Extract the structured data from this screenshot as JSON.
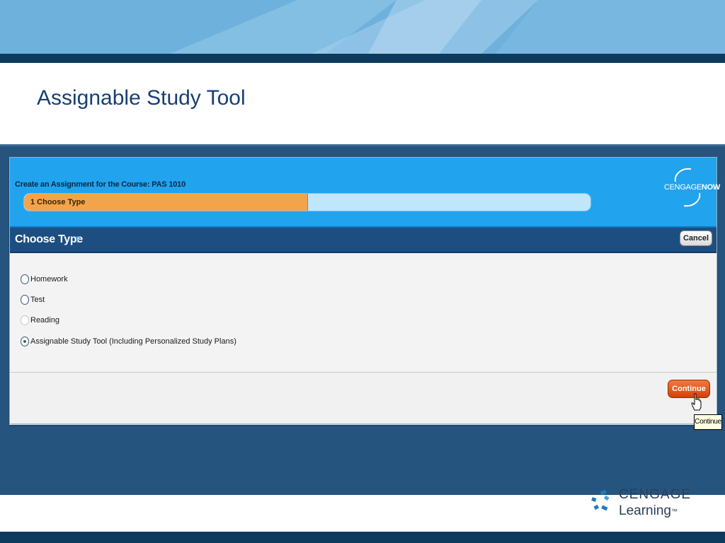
{
  "slide": {
    "title": "Assignable Study Tool"
  },
  "app": {
    "course_title": "Create an Assignment for the Course: PAS 1010",
    "progress": {
      "step_label": "1 Choose Type",
      "fraction": 0.5
    },
    "logo": {
      "prefix": "CENGAGE",
      "suffix": "NOW"
    }
  },
  "choose_bar": {
    "title": "Choose Type",
    "help": "?",
    "cancel_label": "Cancel"
  },
  "options": [
    {
      "label": "Homework",
      "checked": false,
      "disabled": false
    },
    {
      "label": "Test",
      "checked": false,
      "disabled": false
    },
    {
      "label": "Reading",
      "checked": false,
      "disabled": true
    },
    {
      "label": "Assignable Study Tool (Including Personalized Study Plans)",
      "checked": true,
      "disabled": false
    }
  ],
  "footer": {
    "continue_label": "Continue",
    "tooltip": "Continue"
  },
  "brand": {
    "line1": "CENGAGE",
    "line2": "Learning",
    "trademark": "™"
  },
  "colors": {
    "header_blue": "#21a3ee",
    "bar_navy": "#1c4e82",
    "progress_orange": "#f3a44a",
    "continue_orange": "#e05a1c",
    "slide_title": "#173f73"
  }
}
